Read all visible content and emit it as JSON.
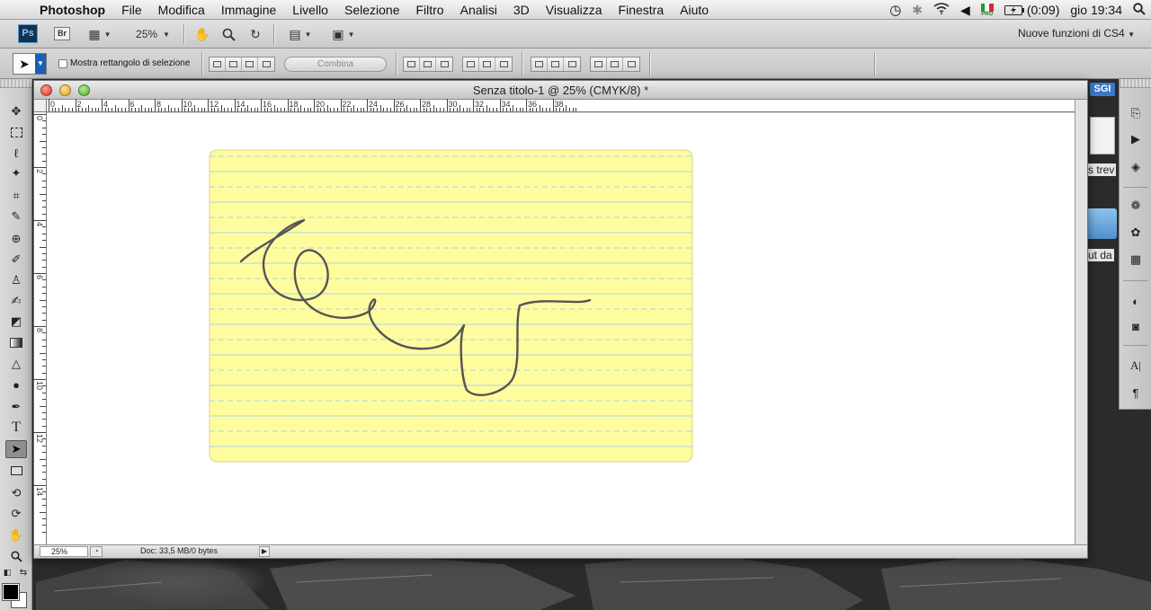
{
  "menubar": {
    "app": "Photoshop",
    "menus": [
      "File",
      "Modifica",
      "Immagine",
      "Livello",
      "Selezione",
      "Filtro",
      "Analisi",
      "3D",
      "Visualizza",
      "Finestra",
      "Aiuto"
    ],
    "battery": "(0:09)",
    "clock": "gio 19:34",
    "flag_label": "PRO"
  },
  "appbar": {
    "ps_logo": "Ps",
    "br_logo": "Br",
    "zoom": "25%",
    "workspace": "Nuove funzioni di CS4"
  },
  "options": {
    "show_bounding_box": "Mostra rettangolo di selezione",
    "combine_button": "Combina"
  },
  "document": {
    "title": "Senza titolo-1 @ 25% (CMYK/8) *",
    "status_zoom": "25%",
    "status_doc": "Doc: 33,5 MB/0 bytes",
    "ruler_h": [
      "0",
      "2",
      "4",
      "6",
      "8",
      "10",
      "12",
      "14",
      "16",
      "18",
      "20",
      "22",
      "24",
      "26",
      "28",
      "30",
      "32",
      "34",
      "36",
      "38"
    ],
    "ruler_v": [
      "0",
      "2",
      "4",
      "6",
      "8",
      "10",
      "12",
      "14"
    ]
  },
  "background_apps": {
    "sgi_badge": "SGI",
    "frag1": "s trev",
    "frag2": "ut da"
  },
  "colors": {
    "notepad_fill": "#fffc9e",
    "notepad_line": "#a9d3e6",
    "stroke": "#555555"
  }
}
